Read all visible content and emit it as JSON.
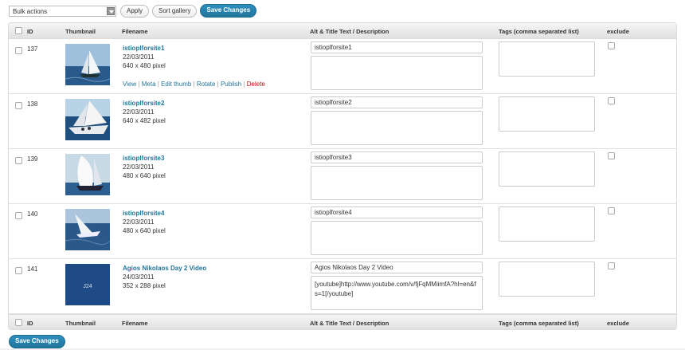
{
  "toolbar": {
    "bulk_actions": "Bulk actions",
    "apply": "Apply",
    "sort_gallery": "Sort gallery",
    "save_changes": "Save Changes"
  },
  "columns": {
    "id": "ID",
    "thumbnail": "Thumbnail",
    "filename": "Filename",
    "alt_title": "Alt & Title Text / Description",
    "tags": "Tags (comma separated list)",
    "exclude": "exclude"
  },
  "row_actions": {
    "view": "View",
    "meta": "Meta",
    "edit_thumb": "Edit thumb",
    "rotate": "Rotate",
    "publish": "Publish",
    "delete": "Delete",
    "separator": " | "
  },
  "rows": [
    {
      "id": "137",
      "name": "istioplforsite1",
      "date": "22/03/2011",
      "size": "640 x 480 pixel",
      "alt": "istioplforsite1",
      "description": "",
      "tags": "",
      "thumb": "sailboat-photo"
    },
    {
      "id": "138",
      "name": "istioplforsite2",
      "date": "22/03/2011",
      "size": "640 x 482 pixel",
      "alt": "istioplforsite2",
      "description": "",
      "tags": "",
      "thumb": "sailboat-photo"
    },
    {
      "id": "139",
      "name": "istioplforsite3",
      "date": "22/03/2011",
      "size": "480 x 640 pixel",
      "alt": "istioplforsite3",
      "description": "",
      "tags": "",
      "thumb": "sailboat-photo"
    },
    {
      "id": "140",
      "name": "istioplforsite4",
      "date": "22/03/2011",
      "size": "480 x 640 pixel",
      "alt": "istioplforsite4",
      "description": "",
      "tags": "",
      "thumb": "sailboat-photo"
    },
    {
      "id": "141",
      "name": "Agios Nikolaos Day 2 Video",
      "date": "24/03/2011",
      "size": "352 x 288 pixel",
      "alt": "Agios Nikolaos Day 2 Video",
      "description": "[youtube]http://www.youtube.com/v/fjFqMMiimfA?hl=en&fs=1[/youtube]",
      "tags": "",
      "thumb": "video-thumbnail",
      "thumb_text": "J24"
    }
  ],
  "bottom": {
    "save_changes": "Save Changes"
  },
  "colors": {
    "accent": "#21759b",
    "delete": "#bc0b0b",
    "header_bg": "#e9e9e9"
  }
}
